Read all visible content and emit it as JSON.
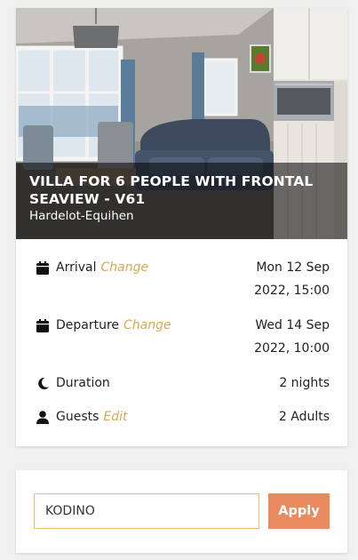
{
  "property": {
    "title": "VILLA FOR 6 PEOPLE WITH FRONTAL SEAVIEW - V61",
    "location": "Hardelot-Equihen"
  },
  "arrival": {
    "label": "Arrival",
    "action": "Change",
    "date": "Mon 12 Sep",
    "year_time": "2022, 15:00",
    "icon": "calendar-icon"
  },
  "departure": {
    "label": "Departure",
    "action": "Change",
    "date": "Wed 14 Sep",
    "year_time": "2022, 10:00",
    "icon": "calendar-icon"
  },
  "duration": {
    "label": "Duration",
    "value": "2 nights",
    "icon": "moon-icon"
  },
  "guests": {
    "label": "Guests",
    "action": "Edit",
    "value": "2 Adults",
    "icon": "user-icon"
  },
  "coupon": {
    "value": "KODINO",
    "apply_label": "Apply"
  },
  "colors": {
    "accent_link": "#d9a94a",
    "apply_button": "#e98a5f",
    "input_border": "#e9c36a"
  }
}
